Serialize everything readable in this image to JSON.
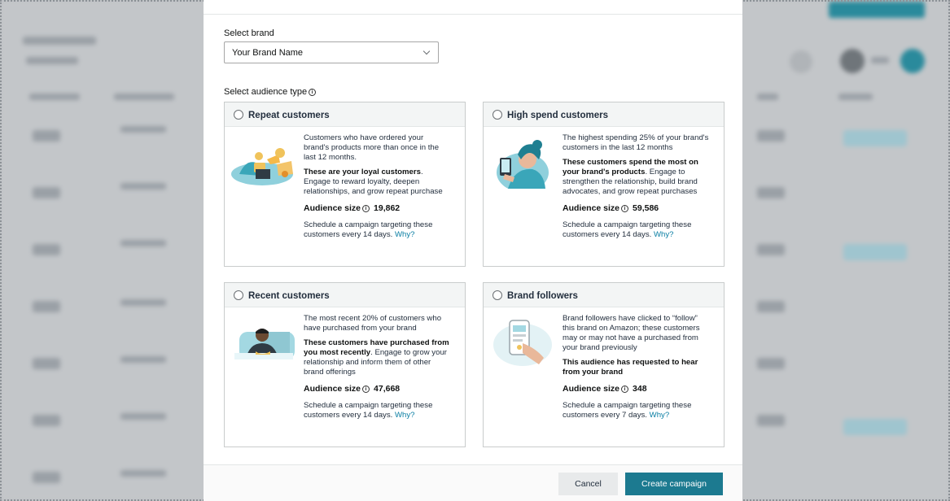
{
  "brand": {
    "label": "Select brand",
    "selected": "Your Brand Name"
  },
  "audience": {
    "label": "Select audience type",
    "cards": [
      {
        "title": "Repeat customers",
        "desc": "Customers who have ordered your brand's products more than once in the last 12 months.",
        "emph": "These are your loyal customers",
        "emph_rest": ". Engage to reward loyalty, deepen relationships, and grow repeat purchase",
        "size_label": "Audience size",
        "size_value": "19,862",
        "schedule": "Schedule a campaign targeting these customers every 14 days.",
        "why": "Why?"
      },
      {
        "title": "High spend customers",
        "desc": "The highest spending 25% of your brand's customers in the last 12 months",
        "emph": "These customers spend the most on your brand's products",
        "emph_rest": ". Engage to strengthen the relationship, build brand advocates, and grow repeat purchases",
        "size_label": "Audience size",
        "size_value": "59,586",
        "schedule": "Schedule a campaign targeting these customers every 14 days.",
        "why": "Why?"
      },
      {
        "title": "Recent customers",
        "desc": "The most recent 20% of customers who have purchased from your brand",
        "emph": "These customers have purchased from you most recently",
        "emph_rest": ". Engage to grow your relationship and inform them of other brand offerings",
        "size_label": "Audience size",
        "size_value": "47,668",
        "schedule": "Schedule a campaign targeting these customers every 14 days.",
        "why": "Why?"
      },
      {
        "title": "Brand followers",
        "desc": "Brand followers have clicked to “follow” this brand on Amazon; these customers may or may not have a purchased from your brand previously",
        "emph": "This audience has requested to hear from your brand",
        "emph_rest": "",
        "size_label": "Audience size",
        "size_value": "348",
        "schedule": "Schedule a campaign targeting these customers every 7 days.",
        "why": "Why?"
      }
    ]
  },
  "footer": {
    "cancel": "Cancel",
    "create": "Create campaign"
  },
  "colors": {
    "primary_button": "#1c7a90",
    "link": "#0a7ea3",
    "illustration_teal": "#3aa6b9"
  }
}
